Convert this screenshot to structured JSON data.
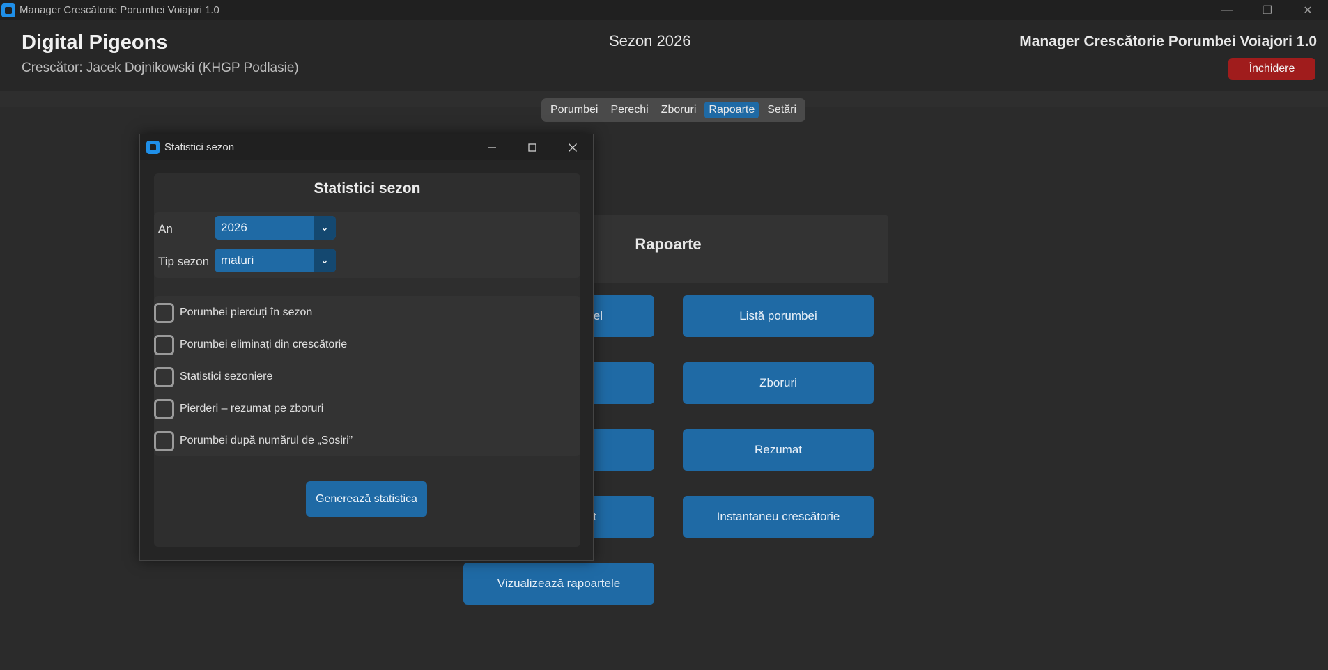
{
  "window": {
    "title": "Manager Crescătorie Porumbei Voiajori 1.0",
    "controls": [
      "—",
      "❐",
      "✕"
    ]
  },
  "header": {
    "brand": "Digital Pigeons",
    "breeder": "Crescător: Jacek Dojnikowski (KHGP Podlasie)",
    "season": "Sezon 2026",
    "app_name": "Manager Crescătorie Porumbei Voiajori 1.0",
    "close_label": "Închidere"
  },
  "tabs": [
    {
      "label": "Porumbei",
      "active": false
    },
    {
      "label": "Perechi",
      "active": false
    },
    {
      "label": "Zboruri",
      "active": false
    },
    {
      "label": "Rapoarte",
      "active": true
    },
    {
      "label": "Setări",
      "active": false
    }
  ],
  "reports": {
    "title": "Rapoarte",
    "left_buttons": [
      "el",
      "",
      "",
      "t",
      "Vizualizează rapoartele"
    ],
    "right_buttons": [
      "Listă porumbei",
      "Zboruri",
      "Rezumat",
      "Instantaneu crescătorie"
    ]
  },
  "dialog": {
    "title": "Statistici sezon",
    "heading": "Statistici sezon",
    "year_label": "An",
    "year_value": "2026",
    "season_type_label": "Tip sezon",
    "season_type_value": "maturi",
    "options": [
      {
        "label": "Porumbei pierduți în sezon",
        "checked": false
      },
      {
        "label": "Porumbei eliminați din crescătorie",
        "checked": false
      },
      {
        "label": "Statistici sezoniere",
        "checked": false
      },
      {
        "label": "Pierderi – rezumat pe zboruri",
        "checked": false
      },
      {
        "label": "Porumbei după numărul de „Sosiri”",
        "checked": false
      }
    ],
    "generate_label": "Generează statistica"
  },
  "colors": {
    "accent": "#1f6aa5",
    "danger": "#a01c1c",
    "background": "#2b2b2b"
  }
}
